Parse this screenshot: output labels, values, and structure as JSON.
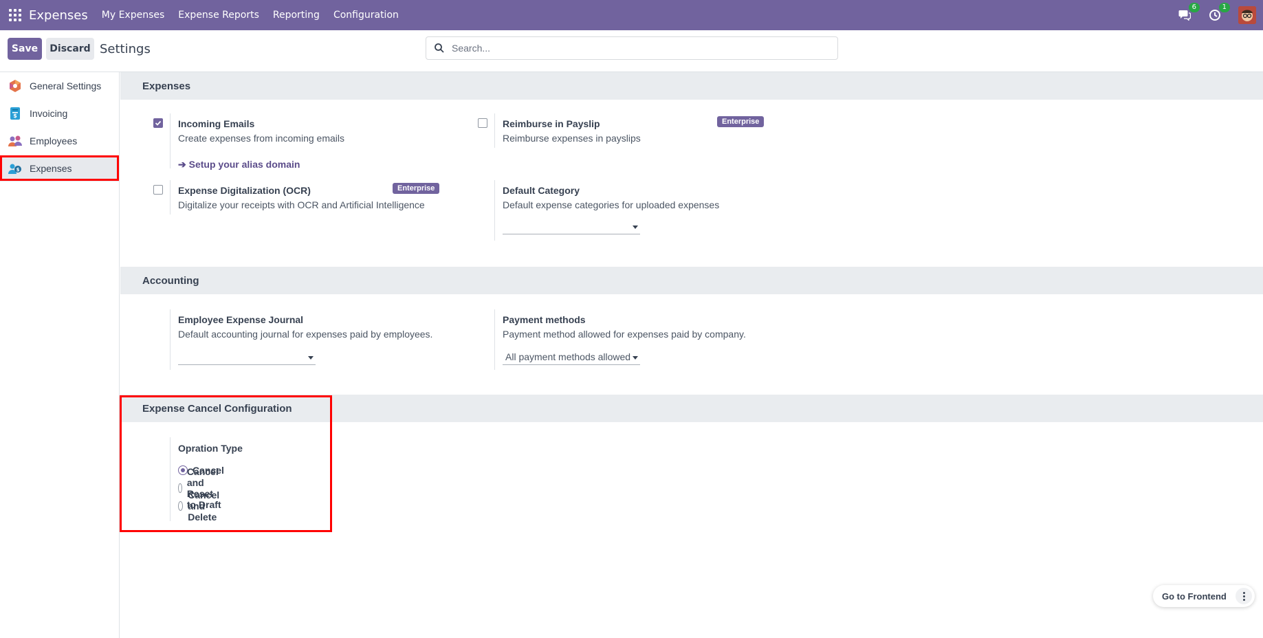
{
  "navbar": {
    "app_name": "Expenses",
    "menu": [
      "My Expenses",
      "Expense Reports",
      "Reporting",
      "Configuration"
    ],
    "messages_count": "6",
    "activities_count": "1"
  },
  "control_panel": {
    "save_label": "Save",
    "discard_label": "Discard",
    "breadcrumb": "Settings",
    "search_placeholder": "Search..."
  },
  "sidebar": {
    "items": [
      {
        "label": "General Settings",
        "icon": "odoo-logo-icon"
      },
      {
        "label": "Invoicing",
        "icon": "invoicing-icon"
      },
      {
        "label": "Employees",
        "icon": "employees-icon"
      },
      {
        "label": "Expenses",
        "icon": "expenses-icon",
        "active": true
      }
    ]
  },
  "sections": {
    "expenses": {
      "title": "Expenses",
      "incoming_emails": {
        "title": "Incoming Emails",
        "desc": "Create expenses from incoming emails",
        "checked": true,
        "link": "Setup your alias domain"
      },
      "reimburse_payslip": {
        "title": "Reimburse in Payslip",
        "desc": "Reimburse expenses in payslips",
        "checked": false,
        "badge": "Enterprise"
      },
      "ocr": {
        "title": "Expense Digitalization (OCR)",
        "desc": "Digitalize your receipts with OCR and Artificial Intelligence",
        "checked": false,
        "badge": "Enterprise"
      },
      "default_category": {
        "title": "Default Category",
        "desc": "Default expense categories for uploaded expenses",
        "value": ""
      }
    },
    "accounting": {
      "title": "Accounting",
      "journal": {
        "title": "Employee Expense Journal",
        "desc": "Default accounting journal for expenses paid by employees.",
        "value": ""
      },
      "payment_methods": {
        "title": "Payment methods",
        "desc": "Payment method allowed for expenses paid by company.",
        "value": "All payment methods allowed"
      }
    },
    "cancel_config": {
      "title": "Expense Cancel Configuration",
      "operation_type_label": "Opration Type",
      "options": [
        "Cancel",
        "Cancel and Reset to Draft",
        "Cancel and Delete"
      ],
      "selected": "Cancel"
    }
  },
  "floating": {
    "go_frontend": "Go to Frontend"
  },
  "colors": {
    "brand": "#71639e",
    "highlight": "#ff0000",
    "badge": "#28a745"
  }
}
